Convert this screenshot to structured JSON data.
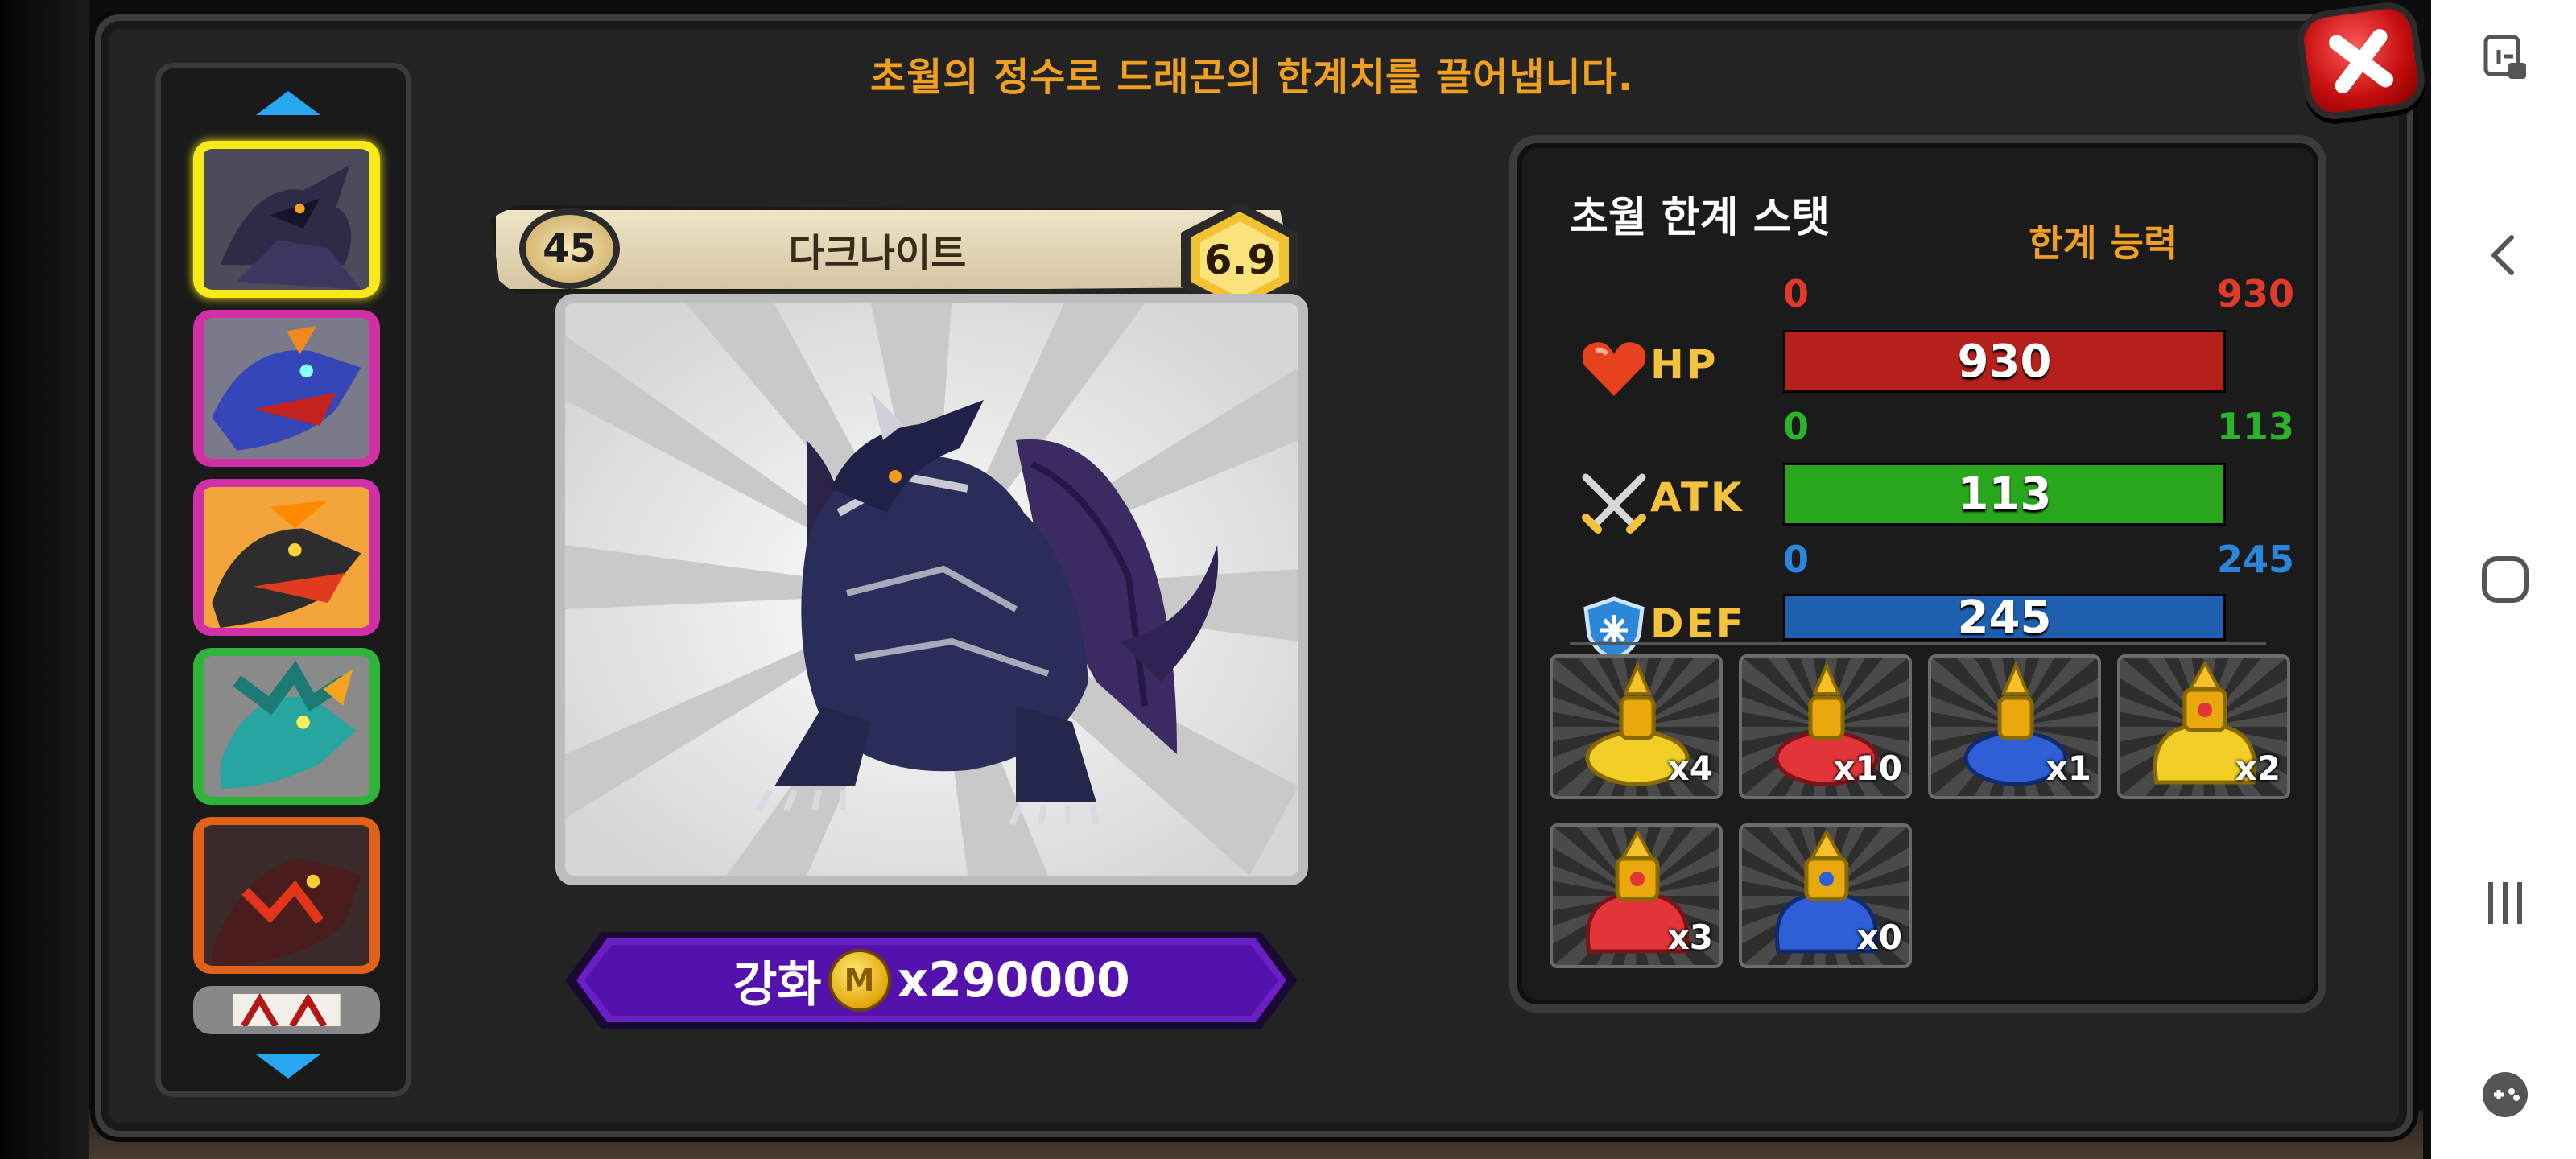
{
  "dialog": {
    "title": "초월의 정수로 드래곤의 한계치를 끌어냅니다."
  },
  "dragon": {
    "name": "다크나이트",
    "level": "45",
    "grade": "6.9"
  },
  "upgrade": {
    "label": "강화",
    "coin_symbol": "M",
    "cost": "x290000"
  },
  "stats": {
    "title": "초월 한계 스탯",
    "limit_label": "한계 능력",
    "items": [
      {
        "name": "HP",
        "min": "0",
        "max": "930",
        "value": "930",
        "fill": 1.0,
        "color": "#b5201c",
        "label_color": "#e23a2a"
      },
      {
        "name": "ATK",
        "min": "0",
        "max": "113",
        "value": "113",
        "fill": 1.0,
        "color": "#28a61c",
        "label_color": "#2bb32a"
      },
      {
        "name": "DEF",
        "min": "0",
        "max": "245",
        "value": "245",
        "fill": 1.0,
        "color": "#1f5fb0",
        "label_color": "#2a86dc"
      }
    ]
  },
  "essences": [
    {
      "qty": "x4",
      "icon": "gold-essence-icon"
    },
    {
      "qty": "x10",
      "icon": "red-essence-icon"
    },
    {
      "qty": "x1",
      "icon": "blue-essence-icon"
    },
    {
      "qty": "x2",
      "icon": "large-gold-essence-icon"
    },
    {
      "qty": "x3",
      "icon": "large-red-essence-icon"
    },
    {
      "qty": "x0",
      "icon": "large-blue-essence-icon"
    }
  ],
  "dragon_list": [
    {
      "icon": "dark-knight-dragon-icon",
      "frame": "#f7ea18",
      "selected": true
    },
    {
      "icon": "blue-dragon-icon",
      "frame": "#d02fa5"
    },
    {
      "icon": "black-fire-dragon-icon",
      "frame": "#d02fa5"
    },
    {
      "icon": "teal-dragon-icon",
      "frame": "#2fb43a"
    },
    {
      "icon": "lava-dragon-icon",
      "frame": "#e0611a"
    },
    {
      "icon": "red-dragon-icon",
      "frame": "#888888"
    }
  ]
}
